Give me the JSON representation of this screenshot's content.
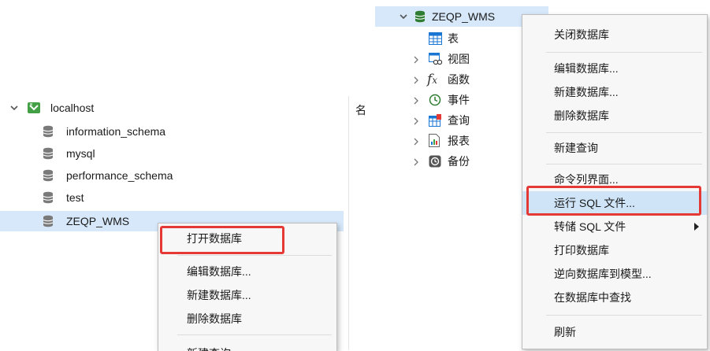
{
  "left_tree": {
    "connection": "localhost",
    "databases": [
      "information_schema",
      "mysql",
      "performance_schema",
      "test",
      "ZEQP_WMS"
    ],
    "column_header": "名"
  },
  "left_menu": {
    "items": [
      "打开数据库",
      "编辑数据库...",
      "新建数据库...",
      "删除数据库",
      "新建查询"
    ]
  },
  "right_tree": {
    "database": "ZEQP_WMS",
    "children": [
      "表",
      "视图",
      "函数",
      "事件",
      "查询",
      "报表",
      "备份"
    ]
  },
  "right_menu": {
    "items": [
      "关闭数据库",
      "编辑数据库...",
      "新建数据库...",
      "删除数据库",
      "新建查询",
      "命令列界面...",
      "运行 SQL 文件...",
      "转储 SQL 文件",
      "打印数据库",
      "逆向数据库到模型...",
      "在数据库中查找",
      "刷新"
    ]
  },
  "colors": {
    "selection": "#d6e8fa",
    "highlight": "#cfe4f7",
    "annotation_red": "#e53935",
    "connection_icon": "#43a047",
    "db_icon_active": "#2e7d32",
    "db_icon": "#7a7a7a"
  }
}
